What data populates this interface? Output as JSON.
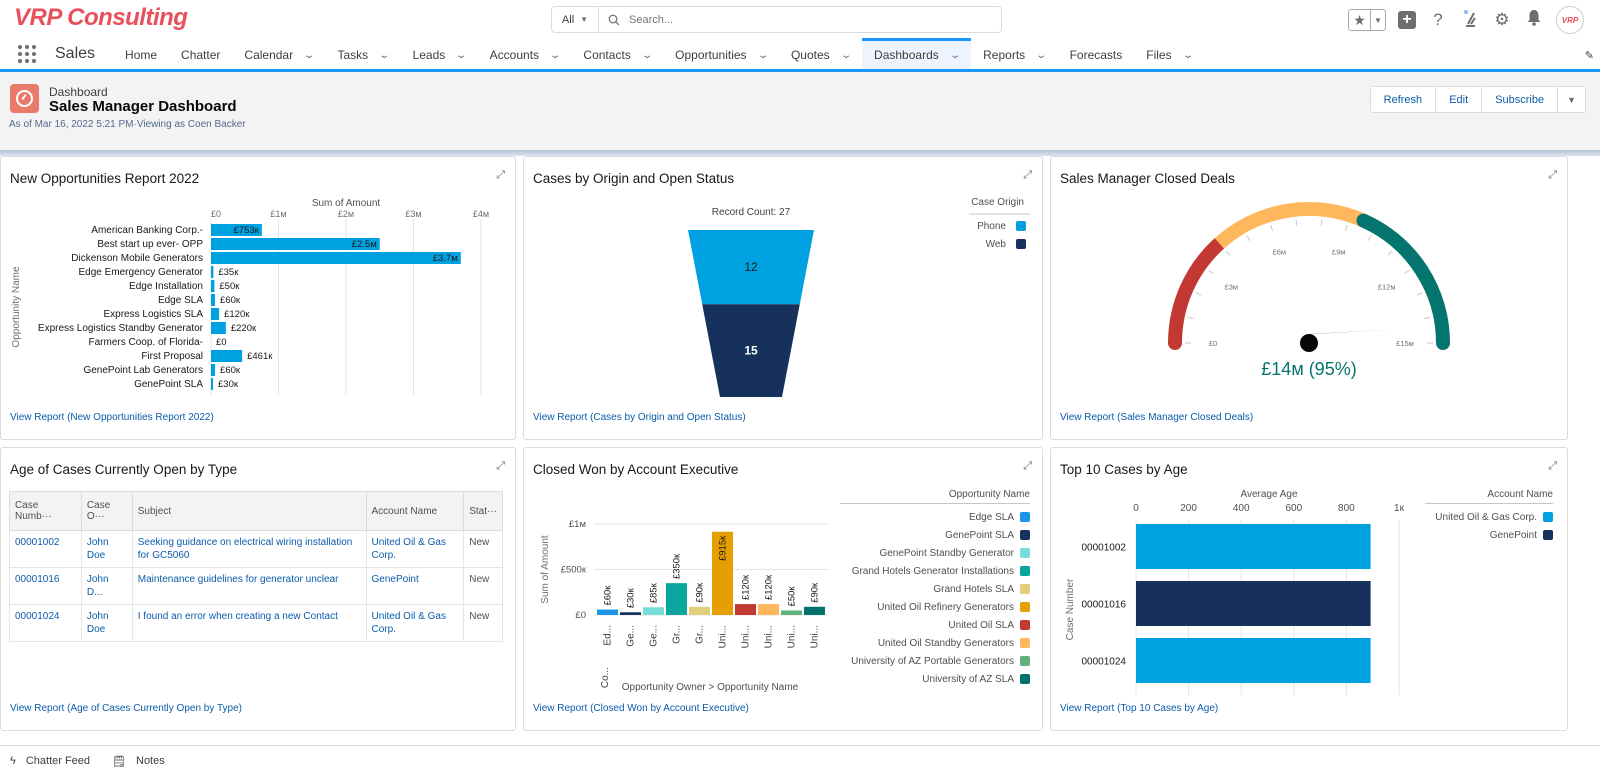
{
  "brand": {
    "logo_text": "VRP Consulting",
    "avatar_text": "VRP"
  },
  "search": {
    "scope": "All",
    "placeholder": "Search..."
  },
  "header_icons": [
    "favorites-star-icon",
    "global-add-icon",
    "help-icon",
    "trailhead-icon",
    "setup-gear-icon",
    "notifications-bell-icon"
  ],
  "nav": {
    "app_name": "Sales",
    "items": [
      {
        "label": "Home",
        "dropdown": false
      },
      {
        "label": "Chatter",
        "dropdown": false
      },
      {
        "label": "Calendar",
        "dropdown": true
      },
      {
        "label": "Tasks",
        "dropdown": true
      },
      {
        "label": "Leads",
        "dropdown": true
      },
      {
        "label": "Accounts",
        "dropdown": true
      },
      {
        "label": "Contacts",
        "dropdown": true
      },
      {
        "label": "Opportunities",
        "dropdown": true
      },
      {
        "label": "Quotes",
        "dropdown": true
      },
      {
        "label": "Dashboards",
        "dropdown": true,
        "active": true
      },
      {
        "label": "Reports",
        "dropdown": true
      },
      {
        "label": "Forecasts",
        "dropdown": false
      },
      {
        "label": "Files",
        "dropdown": true
      }
    ]
  },
  "dashboard": {
    "type_label": "Dashboard",
    "title": "Sales Manager Dashboard",
    "meta": "As of Mar 16, 2022 5:21 PM·Viewing as Coen Backer",
    "buttons": {
      "refresh": "Refresh",
      "edit": "Edit",
      "subscribe": "Subscribe"
    }
  },
  "colors": {
    "accent": "#1b96ff",
    "link": "#0b5cab",
    "bar_blue": "#00a1e0",
    "navy": "#16325c"
  },
  "panels": {
    "new_opps": {
      "title": "New Opportunities Report 2022",
      "link": "View Report (New Opportunities Report 2022)"
    },
    "cases_origin": {
      "title": "Cases by Origin and Open Status",
      "link": "View Report (Cases by Origin and Open Status)"
    },
    "closed_deals": {
      "title": "Sales Manager Closed Deals",
      "link": "View Report (Sales Manager Closed Deals)"
    },
    "age_cases": {
      "title": "Age of Cases Currently Open by Type",
      "link": "View Report (Age of Cases Currently Open by Type)"
    },
    "closed_won": {
      "title": "Closed Won by Account Executive",
      "link": "View Report (Closed Won by Account Executive)"
    },
    "top_cases": {
      "title": "Top 10 Cases by Age",
      "link": "View Report (Top 10 Cases by Age)"
    }
  },
  "cases_table": {
    "columns": [
      "Case Numb···",
      "Case O···",
      "Subject",
      "Account Name",
      "Stat···"
    ],
    "rows": [
      [
        "00001002",
        "John Doe",
        "Seeking guidance on electrical wiring installation for GC5060",
        "United Oil & Gas Corp.",
        "New"
      ],
      [
        "00001016",
        "John D...",
        "Maintenance guidelines for generator unclear",
        "GenePoint",
        "New"
      ],
      [
        "00001024",
        "John Doe",
        "I found an error when creating a new Contact",
        "United Oil & Gas Corp.",
        "New"
      ]
    ]
  },
  "utility_bar": {
    "chatter": "Chatter Feed",
    "notes": "Notes"
  },
  "chart_data": [
    {
      "id": "new_opps",
      "type": "bar",
      "orientation": "horizontal",
      "title": "New Opportunities Report 2022",
      "xlabel": "Sum of Amount",
      "ylabel": "Opportunity Name",
      "xlim": [
        0,
        4000000
      ],
      "ticks": [
        {
          "v": 0,
          "label": "£0"
        },
        {
          "v": 1000000,
          "label": "£1м"
        },
        {
          "v": 2000000,
          "label": "£2м"
        },
        {
          "v": 3000000,
          "label": "£3м"
        },
        {
          "v": 4000000,
          "label": "£4м"
        }
      ],
      "categories": [
        "American Banking Corp.-",
        "Best start up ever- OPP",
        "Dickenson Mobile Generators",
        "Edge Emergency Generator",
        "Edge Installation",
        "Edge SLA",
        "Express Logistics SLA",
        "Express Logistics Standby Generator",
        "Farmers Coop. of Florida-",
        "First Proposal",
        "GenePoint Lab Generators",
        "GenePoint SLA"
      ],
      "values": [
        753000,
        2500000,
        3700000,
        35000,
        50000,
        60000,
        120000,
        220000,
        0,
        461000,
        60000,
        30000
      ],
      "labels": [
        "£753к",
        "£2.5м",
        "£3.7м",
        "£35к",
        "£50к",
        "£60к",
        "£120к",
        "£220к",
        "£0",
        "£461к",
        "£60к",
        "£30к"
      ],
      "color": "#00a1e0"
    },
    {
      "id": "cases_origin",
      "type": "funnel",
      "title": "Cases by Origin and Open Status",
      "subtitle": "Record Count: 27",
      "legend_title": "Case Origin",
      "legend_position": "top-right",
      "series": [
        {
          "name": "Phone",
          "value": 12,
          "color": "#00a1e0"
        },
        {
          "name": "Web",
          "value": 15,
          "color": "#16325c"
        }
      ]
    },
    {
      "id": "closed_deals",
      "type": "gauge",
      "title": "Sales Manager Closed Deals",
      "range": [
        0,
        15000000
      ],
      "value": 14250000,
      "value_label": "£14м (95%)",
      "tick_labels": [
        {
          "v": 0,
          "label": "£0"
        },
        {
          "v": 3000000,
          "label": "£3м"
        },
        {
          "v": 6000000,
          "label": "£6м"
        },
        {
          "v": 9000000,
          "label": "£9м"
        },
        {
          "v": 12000000,
          "label": "£12м"
        },
        {
          "v": 15000000,
          "label": "£15м"
        }
      ],
      "bands": [
        {
          "from": 0,
          "to": 4000000,
          "color": "#c23934"
        },
        {
          "from": 4000000,
          "to": 9500000,
          "color": "#ffb75d"
        },
        {
          "from": 9500000,
          "to": 15000000,
          "color": "#04756e"
        }
      ]
    },
    {
      "id": "closed_won",
      "type": "bar",
      "orientation": "vertical",
      "title": "Closed Won by Account Executive",
      "xlabel": "Opportunity Owner  >  Opportunity Name",
      "ylabel": "Sum of Amount",
      "ylim": [
        0,
        1000000
      ],
      "ticks": [
        {
          "v": 0,
          "label": "£0"
        },
        {
          "v": 500000,
          "label": "£500к"
        },
        {
          "v": 1000000,
          "label": "£1м"
        }
      ],
      "group_label": "Co...",
      "legend_title": "Opportunity Name",
      "legend_position": "right",
      "categories": [
        "Ed...",
        "Ge...",
        "Ge...",
        "Gr...",
        "Gr...",
        "Uni...",
        "Uni...",
        "Uni...",
        "Uni...",
        "Uni..."
      ],
      "series": [
        {
          "name": "Edge SLA",
          "value": 60000,
          "label": "£60к",
          "color": "#1b96e8"
        },
        {
          "name": "GenePoint SLA",
          "value": 30000,
          "label": "£30к",
          "color": "#16325c"
        },
        {
          "name": "GenePoint Standby Generator",
          "value": 85000,
          "label": "£85к",
          "color": "#76ded9"
        },
        {
          "name": "Grand Hotels Generator Installations",
          "value": 350000,
          "label": "£350к",
          "color": "#08a69e"
        },
        {
          "name": "Grand Hotels SLA",
          "value": 90000,
          "label": "£90к",
          "color": "#e2ce7d"
        },
        {
          "name": "United Oil Refinery Generators",
          "value": 915000,
          "label": "£915к",
          "color": "#e69f00"
        },
        {
          "name": "United Oil SLA",
          "value": 120000,
          "label": "£120к",
          "color": "#c23934"
        },
        {
          "name": "United Oil Standby Generators",
          "value": 120000,
          "label": "£120к",
          "color": "#ffb75d"
        },
        {
          "name": "University of AZ Portable Generators",
          "value": 50000,
          "label": "£50к",
          "color": "#60b17d"
        },
        {
          "name": "University of AZ SLA",
          "value": 90000,
          "label": "£90к",
          "color": "#00716b"
        }
      ]
    },
    {
      "id": "top_cases",
      "type": "bar",
      "orientation": "horizontal",
      "title": "Top 10 Cases by Age",
      "xlabel": "Average Age",
      "ylabel": "Case Number",
      "xlim": [
        0,
        1000
      ],
      "ticks": [
        {
          "v": 0,
          "label": "0"
        },
        {
          "v": 200,
          "label": "200"
        },
        {
          "v": 400,
          "label": "400"
        },
        {
          "v": 600,
          "label": "600"
        },
        {
          "v": 800,
          "label": "800"
        },
        {
          "v": 1000,
          "label": "1к"
        }
      ],
      "legend_title": "Account Name",
      "legend_position": "top-right",
      "legend": [
        {
          "name": "United Oil & Gas Corp.",
          "color": "#00a1e0"
        },
        {
          "name": "GenePoint",
          "color": "#16325c"
        }
      ],
      "categories": [
        "00001002",
        "00001016",
        "00001024"
      ],
      "values": [
        892,
        892,
        892
      ],
      "accounts": [
        "United Oil & Gas Corp.",
        "GenePoint",
        "United Oil & Gas Corp."
      ]
    }
  ]
}
